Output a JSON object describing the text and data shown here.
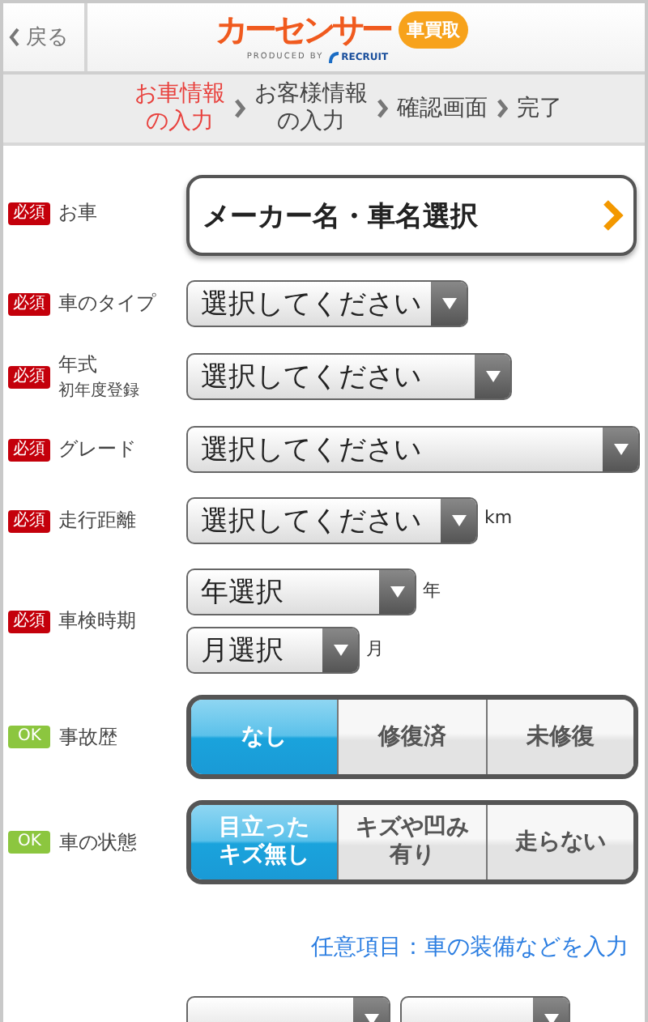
{
  "header": {
    "back": "戻る",
    "logo": "カーセンサー",
    "logo_badge": "車買取",
    "produced_by": "PRODUCED BY",
    "recruit": "RECRUIT"
  },
  "steps": [
    {
      "lines": [
        "お車情報",
        "の入力"
      ],
      "selected": true
    },
    {
      "lines": [
        "お客様情報",
        "の入力"
      ],
      "selected": false
    },
    {
      "lines": [
        "確認画面"
      ],
      "selected": false
    },
    {
      "lines": [
        "完了"
      ],
      "selected": false
    }
  ],
  "fields": [
    {
      "kind": "car_button",
      "badge": {
        "kind": "required",
        "text": "必須"
      },
      "label": "お車",
      "value": "メーカー名・車名選択"
    },
    {
      "kind": "select",
      "badge": {
        "kind": "required",
        "text": "必須"
      },
      "label": "車のタイプ",
      "value": "選択してください"
    },
    {
      "kind": "select",
      "badge": {
        "kind": "required",
        "text": "必須"
      },
      "label": "年式",
      "sublabel": "初年度登録",
      "value": "選択してください"
    },
    {
      "kind": "select",
      "badge": {
        "kind": "required",
        "text": "必須"
      },
      "label": "グレード",
      "value": "選択してください"
    },
    {
      "kind": "select",
      "badge": {
        "kind": "required",
        "text": "必須"
      },
      "label": "走行距離",
      "value": "選択してください",
      "unit": "km"
    },
    {
      "kind": "select_pair",
      "badge": {
        "kind": "required",
        "text": "必須"
      },
      "label": "車検時期",
      "selects": [
        {
          "value": "年選択",
          "unit": "年"
        },
        {
          "value": "月選択",
          "unit": "月"
        }
      ]
    },
    {
      "kind": "segmented",
      "badge": {
        "kind": "ok",
        "text": "OK"
      },
      "label": "事故歴",
      "options": [
        {
          "lines": [
            "なし"
          ],
          "selected": true
        },
        {
          "lines": [
            "修復済"
          ],
          "selected": false
        },
        {
          "lines": [
            "未修復"
          ],
          "selected": false
        }
      ]
    },
    {
      "kind": "segmented",
      "badge": {
        "kind": "ok",
        "text": "OK"
      },
      "label": "車の状態",
      "options": [
        {
          "lines": [
            "目立った",
            "キズ無し"
          ],
          "selected": true
        },
        {
          "lines": [
            "キズや凹み",
            "有り"
          ],
          "selected": false
        },
        {
          "lines": [
            "走らない"
          ],
          "selected": false
        }
      ]
    }
  ],
  "optional_link": "任意項目：車の装備などを入力"
}
